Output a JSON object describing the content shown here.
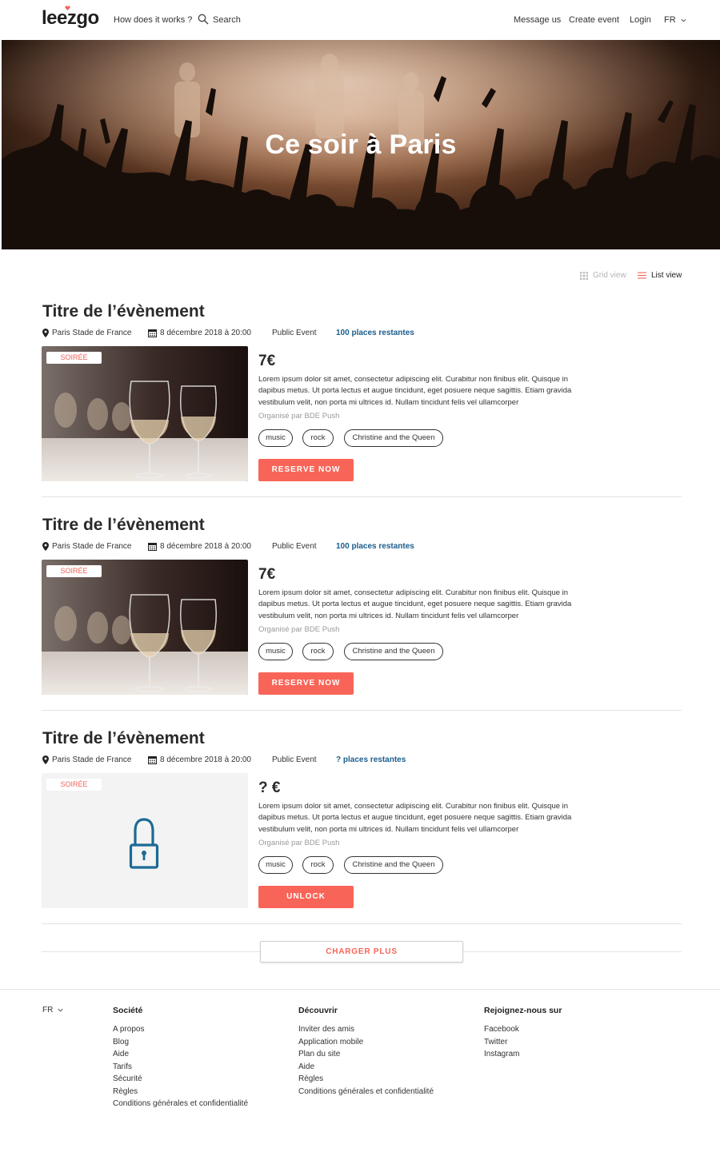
{
  "header": {
    "logo": "leezgo",
    "nav": {
      "how": "How does it works ?",
      "search": "Search",
      "message": "Message us",
      "create": "Create event",
      "login": "Login",
      "lang": "FR"
    }
  },
  "hero": {
    "title": "Ce soir à Paris"
  },
  "view": {
    "grid": "Grid view",
    "list": "List view"
  },
  "events": [
    {
      "title": "Titre de l’évènement",
      "location": "Paris Stade de France",
      "date": "8 décembre 2018 à 20:00",
      "type": "Public Event",
      "places": "100 places restantes",
      "tag": "SOIRÉE",
      "price": "7€",
      "description": "Lorem ipsum dolor sit amet, consectetur adipiscing elit. Curabitur non finibus elit. Quisque in dapibus metus. Ut porta lectus et augue tincidunt, eget posuere neque sagittis. Etiam gravida vestibulum velit, non porta mi ultrices id. Nullam tincidunt felis vel ullamcorper",
      "organizer": "Organisé par BDE Push",
      "chips": [
        "music",
        "rock",
        "Christine and the Queen"
      ],
      "button": "RESERVE NOW"
    },
    {
      "title": "Titre de l’évènement",
      "location": "Paris Stade de France",
      "date": "8 décembre 2018 à 20:00",
      "type": "Public Event",
      "places": "100 places restantes",
      "tag": "SOIRÉE",
      "price": "7€",
      "description": "Lorem ipsum dolor sit amet, consectetur adipiscing elit. Curabitur non finibus elit. Quisque in dapibus metus. Ut porta lectus et augue tincidunt, eget posuere neque sagittis. Etiam gravida vestibulum velit, non porta mi ultrices id. Nullam tincidunt felis vel ullamcorper",
      "organizer": "Organisé par BDE Push",
      "chips": [
        "music",
        "rock",
        "Christine and the Queen"
      ],
      "button": "RESERVE NOW"
    },
    {
      "title": "Titre de l’évènement",
      "location": "Paris Stade de France",
      "date": "8 décembre 2018 à 20:00",
      "type": "Public Event",
      "places": "? places restantes",
      "tag": "SOIRÉE",
      "price": "? €",
      "description": "Lorem ipsum dolor sit amet, consectetur adipiscing elit. Curabitur non finibus elit. Quisque in dapibus metus. Ut porta lectus et augue tincidunt, eget posuere neque sagittis. Etiam gravida vestibulum velit, non porta mi ultrices id. Nullam tincidunt felis vel ullamcorper",
      "organizer": "Organisé par BDE Push",
      "chips": [
        "music",
        "rock",
        "Christine and the Queen"
      ],
      "button": "UNLOCK"
    }
  ],
  "load_more": "CHARGER PLUS",
  "footer": {
    "lang": "FR",
    "columns": [
      {
        "title": "Société",
        "links": [
          "A propos",
          "Blog",
          "Aide",
          "Tarifs",
          "Sécurité",
          "Règles",
          "Conditions générales et confidentialité"
        ]
      },
      {
        "title": "Découvrir",
        "links": [
          "Inviter des amis",
          "Application mobile",
          "Plan du site",
          "Aide",
          "Règles",
          "Conditions générales et confidentialité"
        ]
      },
      {
        "title": "Rejoignez-nous sur",
        "links": [
          "Facebook",
          "Twitter",
          "Instagram"
        ]
      }
    ]
  },
  "colors": {
    "accent": "#f86558",
    "link_blue": "#1b5d8c",
    "lock_blue": "#1b6a96"
  },
  "icons": [
    "search-icon",
    "chevron-down-icon",
    "grid-icon",
    "list-icon",
    "location-pin-icon",
    "calendar-icon",
    "lock-icon"
  ]
}
